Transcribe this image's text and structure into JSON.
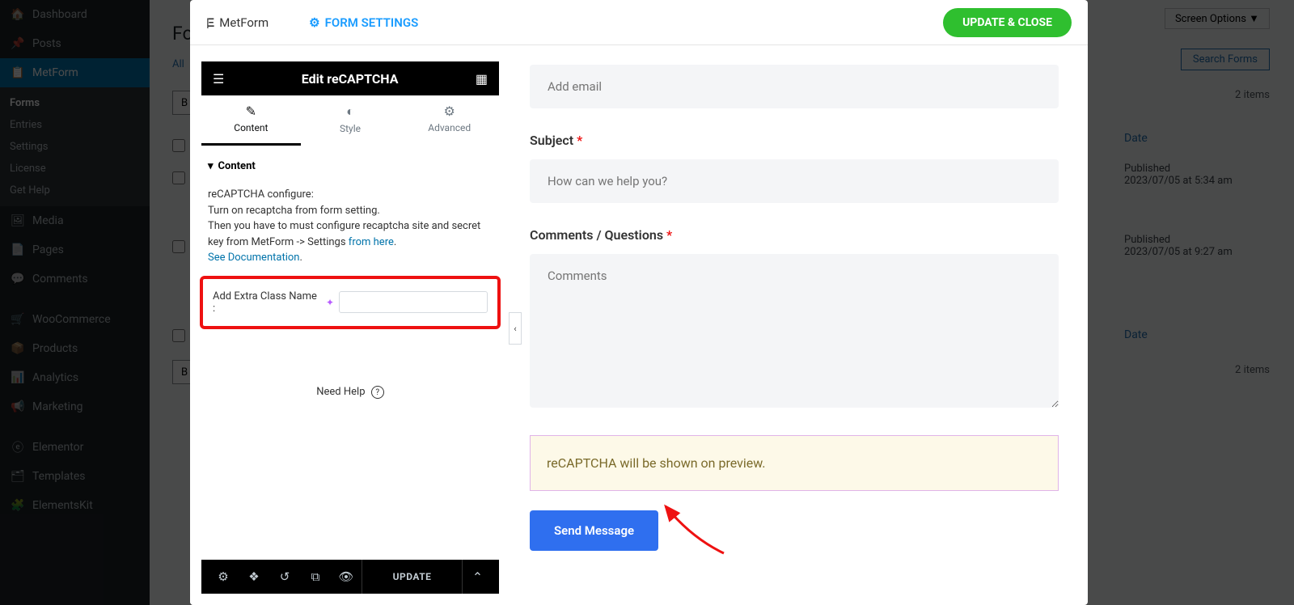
{
  "wpSidebar": {
    "items": [
      {
        "label": "Dashboard"
      },
      {
        "label": "Posts"
      },
      {
        "label": "MetForm"
      },
      {
        "label": "Media"
      },
      {
        "label": "Pages"
      },
      {
        "label": "Comments"
      },
      {
        "label": "WooCommerce"
      },
      {
        "label": "Products"
      },
      {
        "label": "Analytics"
      },
      {
        "label": "Marketing"
      },
      {
        "label": "Elementor"
      },
      {
        "label": "Templates"
      },
      {
        "label": "ElementsKit"
      }
    ],
    "sub": {
      "forms": "Forms",
      "entries": "Entries",
      "settings": "Settings",
      "license": "License",
      "getHelp": "Get Help"
    }
  },
  "bgPage": {
    "title": "Fo",
    "all": "All",
    "screenOptions": "Screen Options ▼",
    "searchForms": "Search Forms",
    "itemsCount": "2 items",
    "dateHead": "Date",
    "row1a": "Published",
    "row1b": "2023/07/05 at 5:34 am",
    "row2a": "Published",
    "row2b": "2023/07/05 at 9:27 am",
    "bulk": "B"
  },
  "modal": {
    "brand": "MetForm",
    "formSettings": "FORM SETTINGS",
    "updateClose": "UPDATE & CLOSE"
  },
  "panel": {
    "title": "Edit reCAPTCHA",
    "tabs": {
      "content": "Content",
      "style": "Style",
      "advanced": "Advanced"
    },
    "sectionTitle": "Content",
    "infoLine1": "reCAPTCHA configure:",
    "infoLine2": "Turn on recaptcha from form setting.",
    "infoLine3": "Then you have to must configure recaptcha site and secret key from MetForm -> Settings ",
    "linkFromHere": "from here",
    "dot1": ".",
    "linkSeeDoc": "See Documentation",
    "dot2": ".",
    "extraClassLabel": "Add Extra Class Name :",
    "needHelp": "Need Help",
    "updateBtn": "UPDATE"
  },
  "preview": {
    "emailPlaceholder": "Add email",
    "subjectLabel": "Subject",
    "subjectPlaceholder": "How can we help you?",
    "commentsLabel": "Comments / Questions",
    "commentsPlaceholder": "Comments",
    "recaptchaNotice": "reCAPTCHA will be shown on preview.",
    "sendBtn": "Send Message"
  }
}
